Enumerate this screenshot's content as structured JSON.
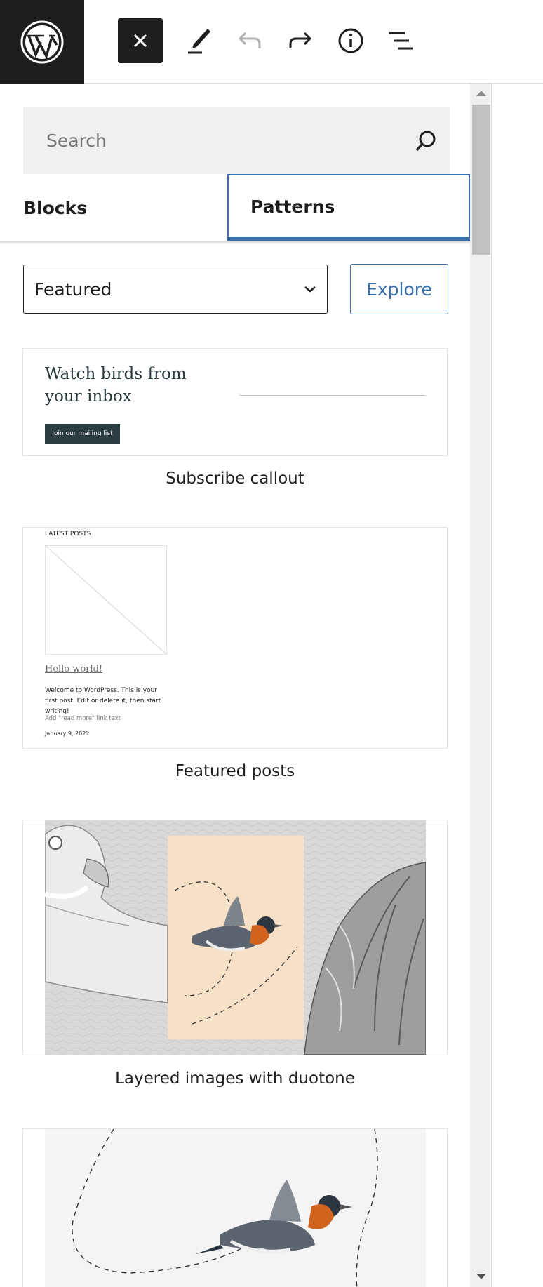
{
  "toolbar": {
    "logo_icon": "wordpress-logo",
    "close_icon": "close-icon",
    "tools_icon": "pencil-icon",
    "undo_icon": "undo-icon",
    "redo_icon": "redo-icon",
    "details_icon": "info-icon",
    "list_view_icon": "list-view-icon"
  },
  "inserter": {
    "search": {
      "placeholder": "Search",
      "value": ""
    },
    "tabs": [
      {
        "label": "Blocks",
        "selected": false
      },
      {
        "label": "Patterns",
        "selected": true
      }
    ],
    "category": {
      "selected": "Featured"
    },
    "explore_label": "Explore",
    "patterns": [
      {
        "label": "Subscribe callout",
        "preview": {
          "heading": "Watch birds from your inbox",
          "button": "Join our mailing list"
        }
      },
      {
        "label": "Featured posts",
        "preview": {
          "heading": "LATEST POSTS",
          "post_title": "Hello world!",
          "excerpt": "Welcome to WordPress. This is your first post. Edit or delete it, then start writing!",
          "read_more": "Add \"read more\" link text",
          "date": "January 9, 2022"
        }
      },
      {
        "label": "Layered images with duotone"
      },
      {
        "label": ""
      }
    ]
  },
  "colors": {
    "accent": "#3a70ad",
    "dark": "#1e1e1e",
    "duotone_peach": "#f6e0c8",
    "subscribe_button": "#2c3d41"
  }
}
